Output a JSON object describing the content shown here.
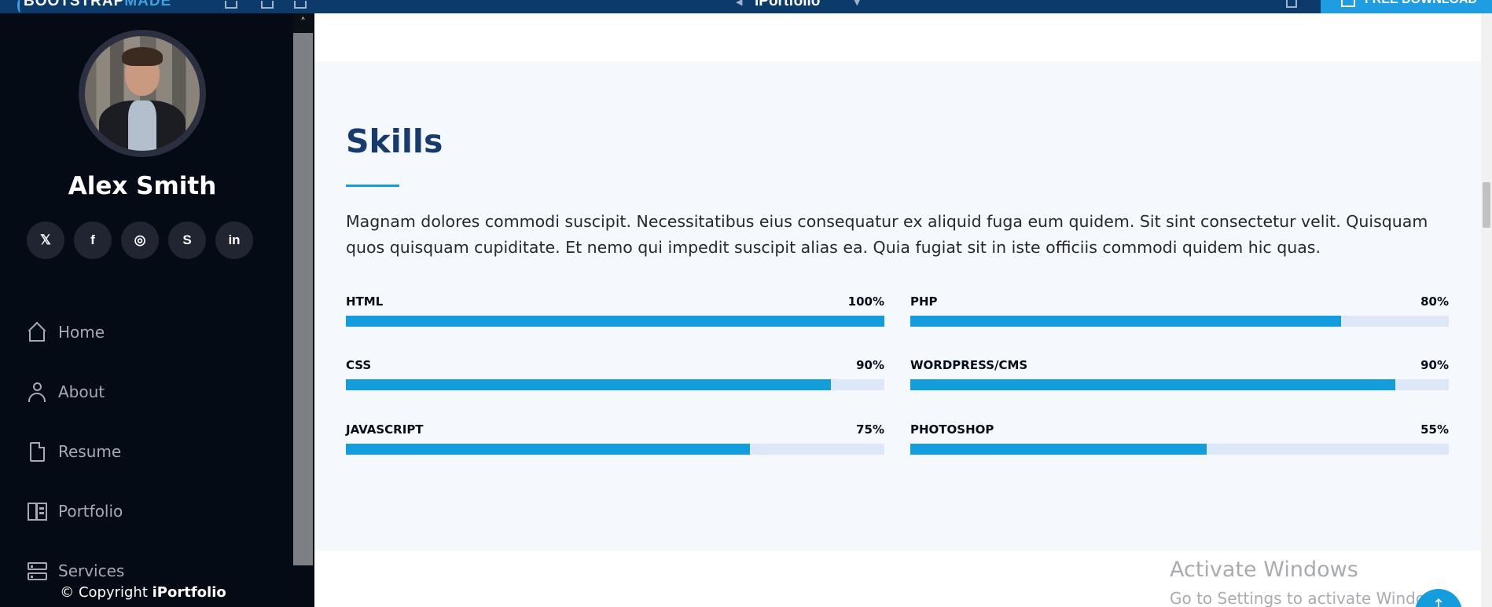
{
  "topbar": {
    "brand": "BOOTSTRAP",
    "brand_accent": "MADE",
    "template_title": "iPortfolio",
    "download_label": "FREE DOWNLOAD"
  },
  "sidebar": {
    "name": "Alex Smith",
    "socials": [
      {
        "icon": "twitter-icon",
        "glyph": "𝕏"
      },
      {
        "icon": "facebook-icon",
        "glyph": "f"
      },
      {
        "icon": "instagram-icon",
        "glyph": "◎"
      },
      {
        "icon": "skype-icon",
        "glyph": "S"
      },
      {
        "icon": "linkedin-icon",
        "glyph": "in"
      }
    ],
    "nav": [
      {
        "label": "Home",
        "icon": "home-icon"
      },
      {
        "label": "About",
        "icon": "user-icon"
      },
      {
        "label": "Resume",
        "icon": "file-icon"
      },
      {
        "label": "Portfolio",
        "icon": "portfolio-icon"
      },
      {
        "label": "Services",
        "icon": "server-icon"
      }
    ],
    "copyright_prefix": "© Copyright",
    "copyright_brand": "iPortfolio"
  },
  "skills": {
    "title": "Skills",
    "description": "Magnam dolores commodi suscipit. Necessitatibus eius consequatur ex aliquid fuga eum quidem. Sit sint consectetur velit. Quisquam quos quisquam cupiditate. Et nemo qui impedit suscipit alias ea. Quia fugiat sit in iste officiis commodi quidem hic quas.",
    "items": [
      {
        "name": "HTML",
        "percent_label": "100%",
        "value": 100
      },
      {
        "name": "PHP",
        "percent_label": "80%",
        "value": 80
      },
      {
        "name": "CSS",
        "percent_label": "90%",
        "value": 90
      },
      {
        "name": "WORDPRESS/CMS",
        "percent_label": "90%",
        "value": 90
      },
      {
        "name": "JAVASCRIPT",
        "percent_label": "75%",
        "value": 75
      },
      {
        "name": "PHOTOSHOP",
        "percent_label": "55%",
        "value": 55
      }
    ]
  },
  "watermark": {
    "line1": "Activate Windows",
    "line2": "Go to Settings to activate Windows."
  },
  "colors": {
    "accent": "#149ddd",
    "sidebar_bg": "#040b14",
    "heading": "#173b6c",
    "track": "#dce8f8"
  }
}
